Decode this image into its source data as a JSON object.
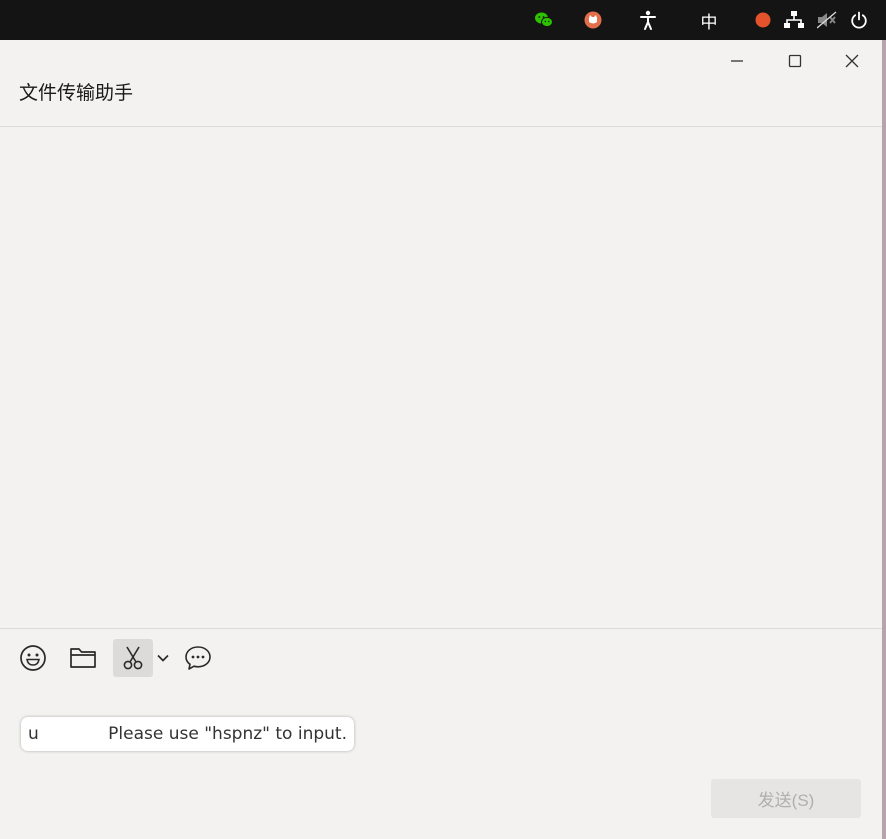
{
  "topbar": {
    "input_method_label": "中"
  },
  "window": {
    "title": "文件传输助手"
  },
  "composer": {
    "ime_composition": "u",
    "ime_hint": "Please use \"hspnz\" to input.",
    "send_label": "发送(S)"
  },
  "icons": {
    "tray": [
      "wechat-icon",
      "cat-app-icon",
      "accessibility-icon",
      "input-method-indicator",
      "record-indicator-icon",
      "network-icon",
      "volume-muted-icon",
      "power-icon"
    ],
    "window_controls": [
      "minimize-icon",
      "maximize-icon",
      "close-icon"
    ],
    "toolbar": [
      "emoji-icon",
      "folder-icon",
      "scissors-icon",
      "chevron-down-icon",
      "chat-history-icon"
    ]
  },
  "colors": {
    "topbar_bg": "#141414",
    "window_bg": "#f3f2f1",
    "record_dot": "#e4532b",
    "wechat_green": "#2dc100",
    "send_disabled_bg": "#e6e5e4"
  }
}
